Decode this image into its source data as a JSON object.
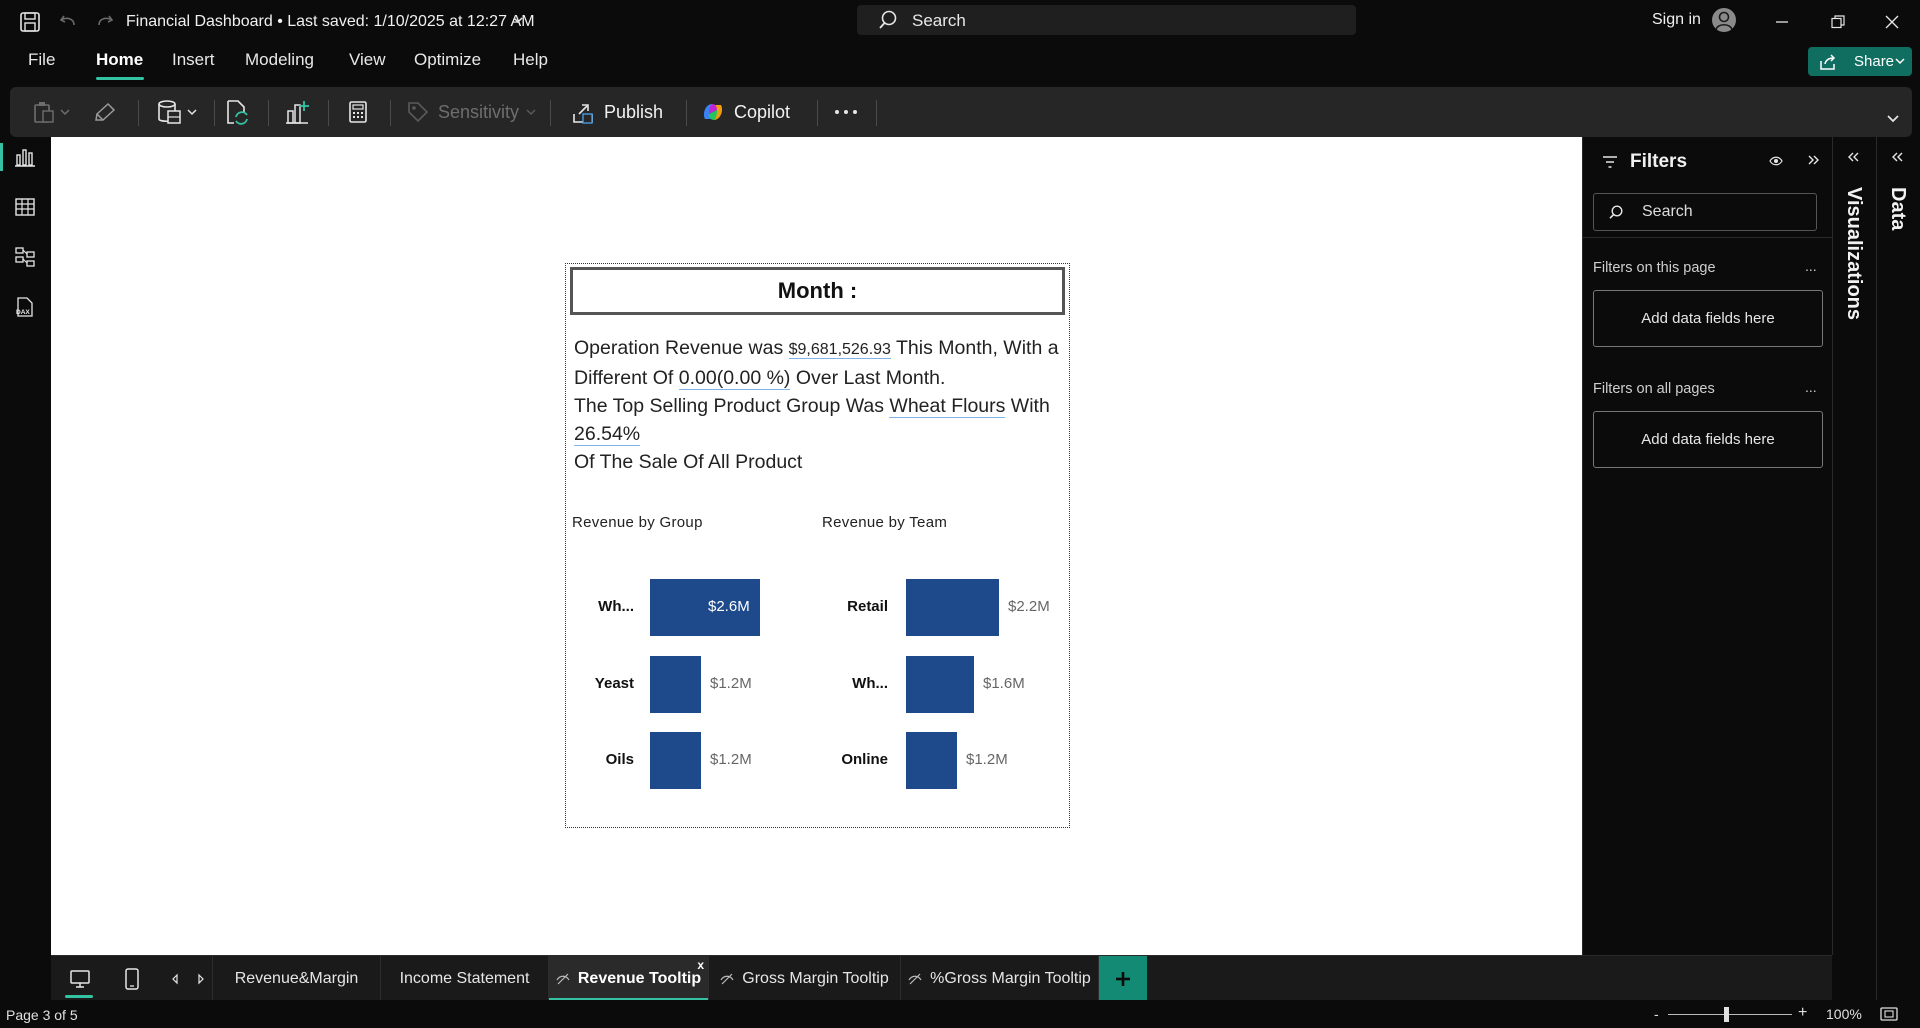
{
  "titlebar": {
    "doc_title": "Financial Dashboard • Last saved: 1/10/2025 at 12:27 AM",
    "search_placeholder": "Search",
    "sign_in": "Sign in"
  },
  "menu": {
    "items": [
      "File",
      "Home",
      "Insert",
      "Modeling",
      "View",
      "Optimize",
      "Help"
    ],
    "active": "Home",
    "share_label": "Share"
  },
  "ribbon": {
    "sensitivity_label": "Sensitivity",
    "publish_label": "Publish",
    "copilot_label": "Copilot"
  },
  "card": {
    "month_title": "Month :",
    "narrative": {
      "p1_a": "Operation Revenue was ",
      "revenue": "$9,681,526.93",
      "p1_b": " This Month, With a Different Of ",
      "diff": "0.00",
      "diff_pct": "(0.00 %)",
      "p1_c": " Over Last Month.",
      "p2_a": "The Top Selling Product Group Was ",
      "top_group": "Wheat Flours",
      "p2_b": " With ",
      "top_share": "26.54%",
      "p3": "Of The Sale Of All Product"
    }
  },
  "chart_data": [
    {
      "type": "bar",
      "orientation": "horizontal",
      "title": "Revenue by Group",
      "categories": [
        "Wh...",
        "Yeast",
        "Oils"
      ],
      "values": [
        2.6,
        1.2,
        1.2
      ],
      "value_labels": [
        "$2.6M",
        "$1.2M",
        "$1.2M"
      ],
      "unit": "$M",
      "color": "#1e4a8c"
    },
    {
      "type": "bar",
      "orientation": "horizontal",
      "title": "Revenue by Team",
      "categories": [
        "Retail",
        "Wh...",
        "Online"
      ],
      "values": [
        2.2,
        1.6,
        1.2
      ],
      "value_labels": [
        "$2.2M",
        "$1.6M",
        "$1.2M"
      ],
      "unit": "$M",
      "color": "#1e4a8c"
    }
  ],
  "filters": {
    "title": "Filters",
    "search_placeholder": "Search",
    "on_this_page": "Filters on this page",
    "on_all_pages": "Filters on all pages",
    "drop_hint": "Add data fields here",
    "more": "..."
  },
  "side_tabs": {
    "visualizations": "Visualizations",
    "data": "Data"
  },
  "page_tabs": {
    "tabs": [
      {
        "label": "Revenue&Margin",
        "hidden": false
      },
      {
        "label": "Income Statement",
        "hidden": false
      },
      {
        "label": "Revenue Tooltip",
        "hidden": true
      },
      {
        "label": "Gross Margin Tooltip",
        "hidden": true
      },
      {
        "label": "%Gross Margin Tooltip",
        "hidden": true
      }
    ],
    "active": "Revenue Tooltip",
    "close": "x"
  },
  "status": {
    "page_indicator": "Page 3 of 5",
    "zoom": "100%",
    "zoom_level": 1.0
  },
  "colors": {
    "accent": "#34c3a2",
    "share": "#0f6e60",
    "bar": "#1e4a8c",
    "add_tab": "#138a73"
  }
}
